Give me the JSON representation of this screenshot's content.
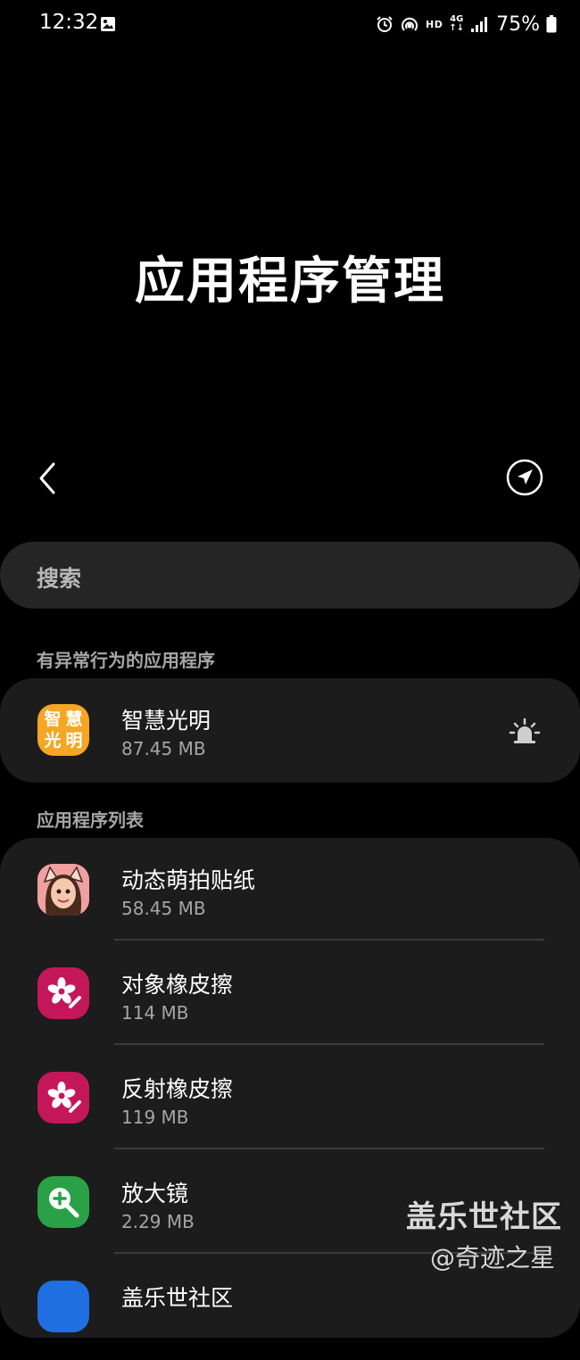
{
  "status_bar": {
    "time": "12:32",
    "hd": "HD",
    "network_top": "4G",
    "network_bottom": "↑↓",
    "battery_percent": "75%",
    "icons": [
      "gallery-icon",
      "alarm-icon",
      "hotspot-icon",
      "signal-icon",
      "battery-icon"
    ]
  },
  "header": {
    "title": "应用程序管理",
    "back_icon": "chevron-left-icon",
    "nav_icon": "navigation-arrow-icon"
  },
  "search": {
    "placeholder": "搜索"
  },
  "abnormal_section": {
    "label": "有异常行为的应用程序",
    "apps": [
      {
        "name": "智慧光明",
        "size": "87.45 MB",
        "icon_text": [
          "智",
          "慧",
          "光",
          "明"
        ],
        "status_icon": "alarm-siren-icon",
        "accent": "#f5a623"
      }
    ]
  },
  "list_section": {
    "label": "应用程序列表",
    "apps": [
      {
        "name": "动态萌拍贴纸",
        "size": "58.45 MB",
        "icon": "ar-emoji-avatar-icon"
      },
      {
        "name": "对象橡皮擦",
        "size": "114 MB",
        "icon": "object-eraser-icon",
        "accent": "#c4175a"
      },
      {
        "name": "反射橡皮擦",
        "size": "119 MB",
        "icon": "reflection-eraser-icon",
        "accent": "#c4175a"
      },
      {
        "name": "放大镜",
        "size": "2.29 MB",
        "icon": "magnifier-icon",
        "accent": "#2aa147"
      },
      {
        "name": "盖乐世社区",
        "icon": "samsung-members-icon",
        "accent": "#1f6fe0"
      }
    ]
  },
  "watermark": {
    "main": "盖乐世社区",
    "sub": "@奇迹之星"
  }
}
